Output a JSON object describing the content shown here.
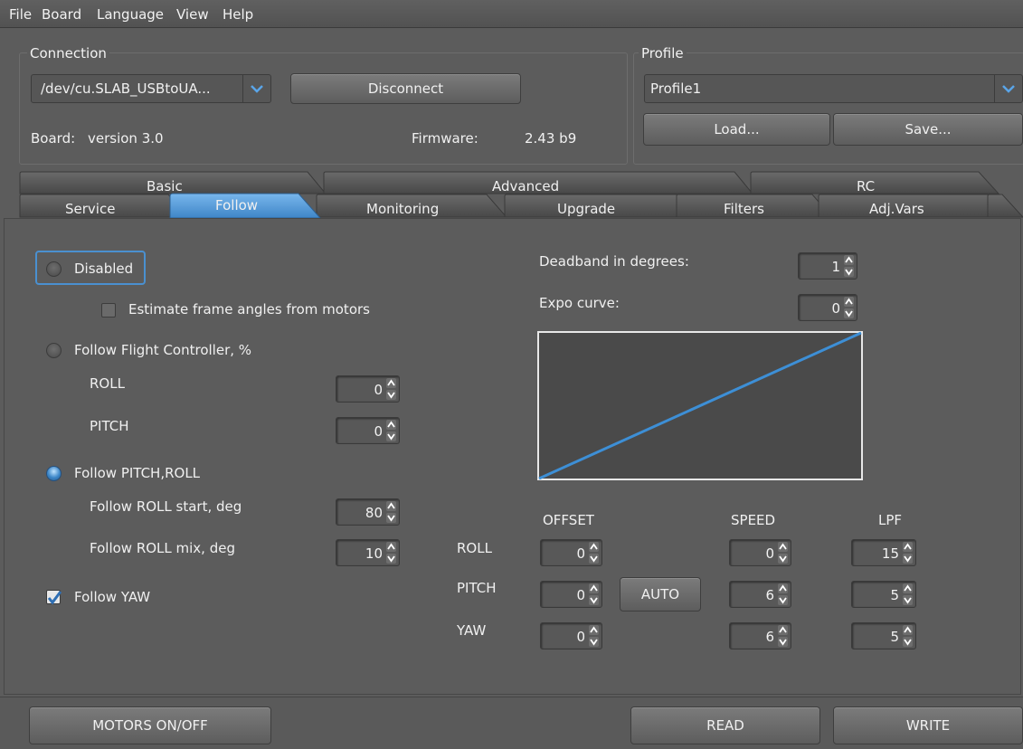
{
  "menu": [
    "File",
    "Board",
    "Language",
    "View",
    "Help"
  ],
  "connection": {
    "title": "Connection",
    "port": "/dev/cu.SLAB_USBtoUA...",
    "disconnect_label": "Disconnect",
    "board_label": "Board:",
    "board_value": "version 3.0",
    "firmware_label": "Firmware:",
    "firmware_value": "2.43 b9"
  },
  "profile": {
    "title": "Profile",
    "selected": "Profile1",
    "load_label": "Load...",
    "save_label": "Save..."
  },
  "tabs_top": [
    "Basic",
    "Advanced",
    "RC"
  ],
  "tabs_bottom": [
    "Service",
    "Follow",
    "Monitoring",
    "Upgrade",
    "Filters",
    "Adj.Vars"
  ],
  "active_tab": "Follow",
  "follow": {
    "disabled_label": "Disabled",
    "estimate_label": "Estimate frame angles from motors",
    "estimate_checked": false,
    "fc_label": "Follow Flight Controller, %",
    "fc_roll_label": "ROLL",
    "fc_roll_value": "0",
    "fc_pitch_label": "PITCH",
    "fc_pitch_value": "0",
    "pitchroll_label": "Follow PITCH,ROLL",
    "roll_start_label": "Follow ROLL start, deg",
    "roll_start_value": "80",
    "roll_mix_label": "Follow ROLL mix, deg",
    "roll_mix_value": "10",
    "yaw_label": "Follow YAW",
    "yaw_checked": true,
    "selected_mode": "Follow PITCH,ROLL",
    "deadband_label": "Deadband in degrees:",
    "deadband_value": "1",
    "expo_label": "Expo curve:",
    "expo_value": "0"
  },
  "axes_table": {
    "headers": {
      "offset": "OFFSET",
      "speed": "SPEED",
      "lpf": "LPF"
    },
    "auto_label": "AUTO",
    "rows": [
      {
        "name": "ROLL",
        "offset": "0",
        "speed": "0",
        "lpf": "15"
      },
      {
        "name": "PITCH",
        "offset": "0",
        "speed": "6",
        "lpf": "5"
      },
      {
        "name": "YAW",
        "offset": "0",
        "speed": "6",
        "lpf": "5"
      }
    ]
  },
  "bottom": {
    "motors_label": "MOTORS ON/OFF",
    "read_label": "READ",
    "write_label": "WRITE"
  },
  "colors": {
    "accent": "#4a90d0",
    "curve": "#3d8fd6",
    "background": "#5c5c5c"
  }
}
